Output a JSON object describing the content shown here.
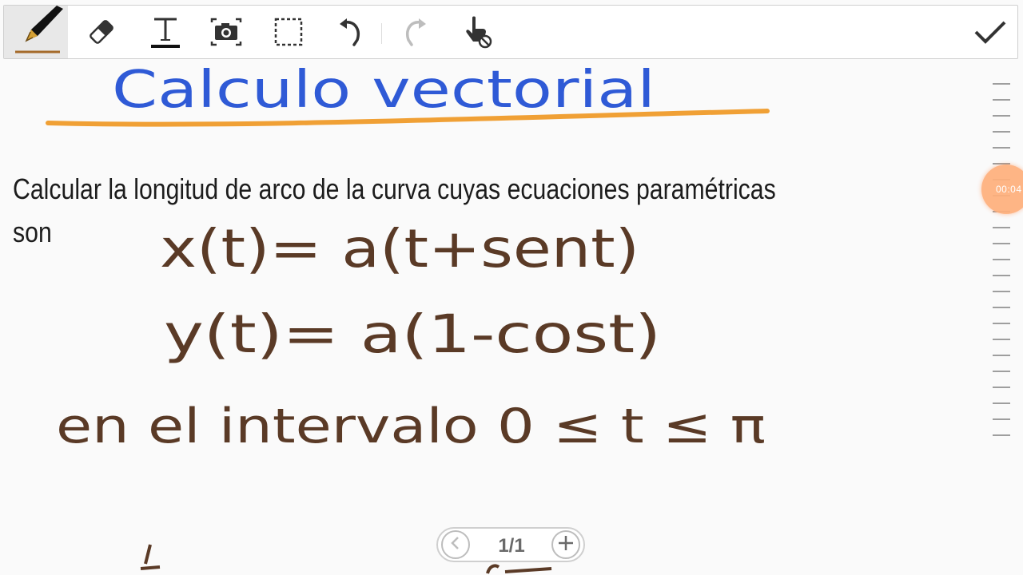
{
  "toolbar": {
    "tools": [
      {
        "name": "pen-icon",
        "active": true
      },
      {
        "name": "eraser-icon"
      },
      {
        "name": "text-icon",
        "label": "T"
      },
      {
        "name": "camera-icon"
      },
      {
        "name": "selection-icon"
      },
      {
        "name": "undo-icon"
      },
      {
        "name": "redo-icon",
        "disabled": true
      },
      {
        "name": "hand-touch-disabled-icon"
      },
      {
        "name": "checkmark-icon"
      }
    ]
  },
  "note": {
    "title": "Calculo vectorial",
    "problem_line1": "Calcular la longitud de arco de la curva cuyas ecuaciones paramétricas",
    "problem_line2": "son",
    "eq_x": "x(t)= a(t+sent)",
    "eq_y": "y(t)= a(1-cost)",
    "interval": "en el intervalo  0 ≤ t ≤ π",
    "colors": {
      "title_ink": "#2f5ad6",
      "underline_ink": "#f0a035",
      "math_ink": "#5a3a26",
      "text": "#1c1c1c"
    }
  },
  "playback": {
    "time": "00:04"
  },
  "pager": {
    "indicator": "1/1",
    "prev_icon": "chevron-left-icon",
    "add_icon": "plus-icon"
  }
}
